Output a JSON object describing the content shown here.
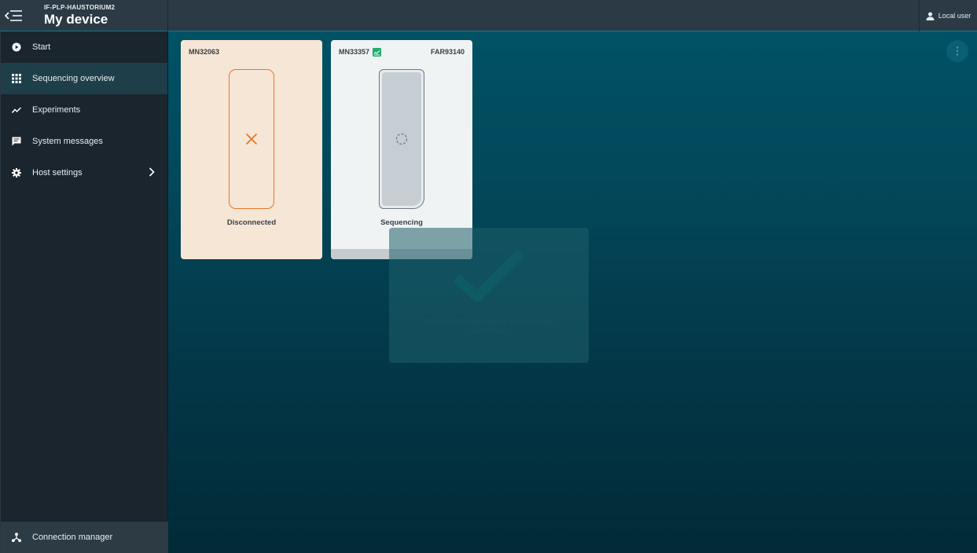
{
  "header": {
    "host_name": "IF-PLP-HAUSTORIUM2",
    "page_title": "My device",
    "user_label": "Local user"
  },
  "sidebar": {
    "items": [
      {
        "label": "Start",
        "icon": "play-circle-icon"
      },
      {
        "label": "Sequencing overview",
        "icon": "grid-icon",
        "active": true
      },
      {
        "label": "Experiments",
        "icon": "trend-line-icon"
      },
      {
        "label": "System messages",
        "icon": "message-icon"
      },
      {
        "label": "Host settings",
        "icon": "gear-icon",
        "has_submenu": true
      }
    ],
    "footer_label": "Connection manager"
  },
  "positions": [
    {
      "name": "MN32063",
      "flow_cell": "",
      "status": "Disconnected",
      "accent": "#e8762d"
    },
    {
      "name": "MN33357",
      "flow_cell": "FAR93140",
      "status": "Sequencing",
      "accent": "#1fae6e"
    }
  ],
  "toast": {
    "message": "Started! Navigating to Sequencing overview."
  },
  "colors": {
    "topbar": "#2b3a44",
    "sidebar": "#1a252d",
    "active_item": "#1e3e4a",
    "main_gradient_top": "#005265",
    "main_gradient_bottom": "#022a37"
  }
}
